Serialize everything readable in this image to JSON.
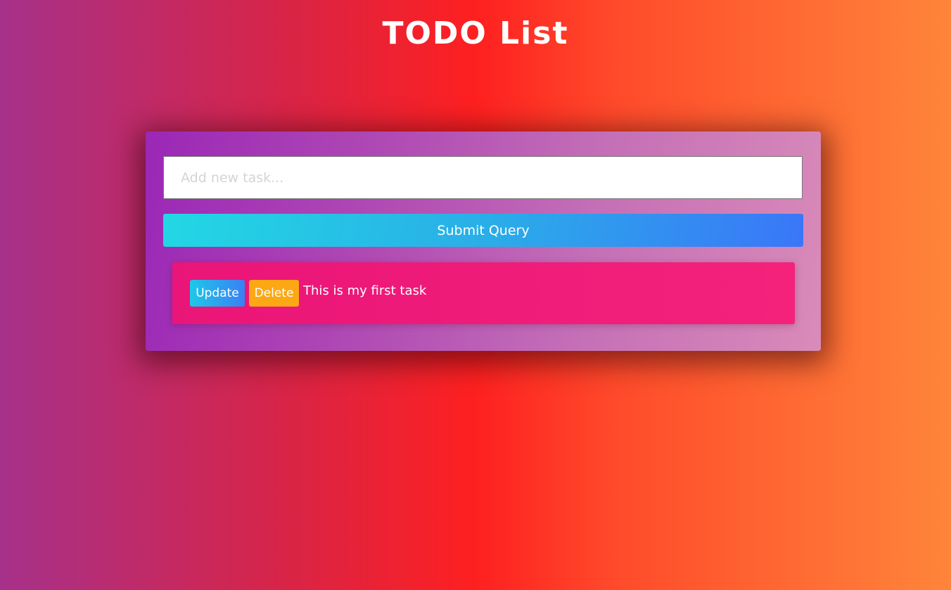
{
  "header": {
    "title": "TODO List"
  },
  "form": {
    "input_placeholder": "Add new task...",
    "input_value": "",
    "submit_label": "Submit Query"
  },
  "tasks": [
    {
      "text": "This is my first task",
      "update_label": "Update",
      "delete_label": "Delete"
    }
  ],
  "colors": {
    "submit_gradient_start": "#22d8e3",
    "submit_gradient_end": "#3a76f8",
    "task_background": "#ea1578",
    "update_gradient_start": "#1ec8e8",
    "update_gradient_end": "#3a80f4",
    "delete_background": "#fca815"
  }
}
